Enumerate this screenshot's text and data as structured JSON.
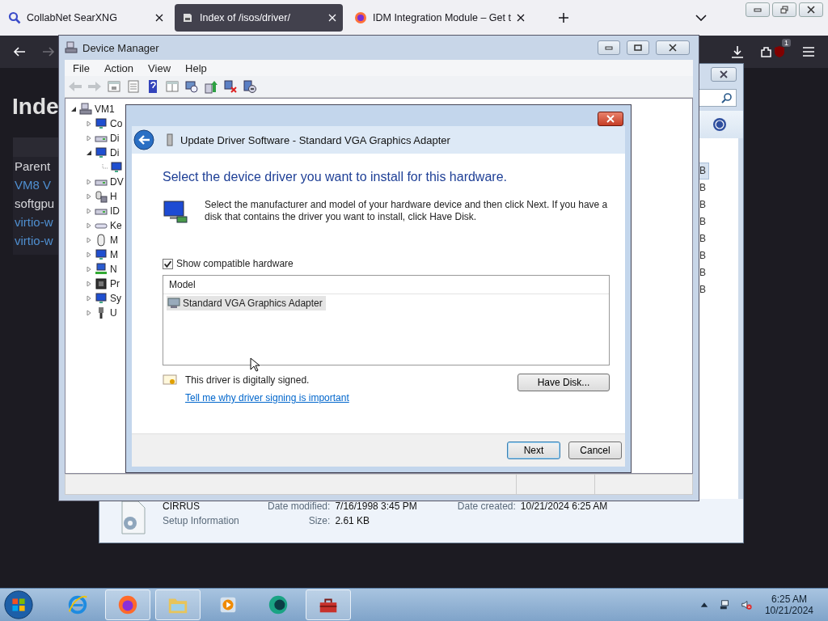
{
  "browser": {
    "tabs": [
      {
        "title": "CollabNet SearXNG",
        "selected": false,
        "kind": "search"
      },
      {
        "title": "Index of /isos/driver/",
        "selected": true,
        "kind": "page"
      },
      {
        "title": "IDM Integration Module – Get t",
        "selected": false,
        "kind": "firefox"
      }
    ],
    "toolbar": {
      "forward_disabled": true,
      "extension_badge": "1"
    },
    "page": {
      "heading": "Inde",
      "rows": [
        {
          "text": "Parent",
          "link": false
        },
        {
          "text": "VM8 V",
          "link": true
        },
        {
          "text": "softgpu",
          "link": false
        },
        {
          "text": "virtio-w",
          "link": true
        },
        {
          "text": "virtio-w",
          "link": true
        }
      ]
    }
  },
  "explorer": {
    "size_column": [
      {
        "text": "B",
        "selected": true
      },
      {
        "text": "B",
        "selected": false
      },
      {
        "text": "B",
        "selected": false
      },
      {
        "text": "B",
        "selected": false
      },
      {
        "text": "B",
        "selected": false
      },
      {
        "text": "B",
        "selected": false
      },
      {
        "text": "B",
        "selected": false
      },
      {
        "text": "B",
        "selected": false
      }
    ],
    "details": {
      "name": "CIRRUS",
      "type": "Setup Information",
      "fields": [
        {
          "label": "Date modified:",
          "value": "7/16/1998 3:45 PM"
        },
        {
          "label": "Size:",
          "value": "2.61 KB"
        },
        {
          "label": "Date created:",
          "value": "10/21/2024 6:25 AM"
        }
      ]
    }
  },
  "device_manager": {
    "title": "Device Manager",
    "menu": [
      "File",
      "Action",
      "View",
      "Help"
    ],
    "toolbar": [
      {
        "kind": "back",
        "disabled": true
      },
      {
        "kind": "forward",
        "disabled": true
      },
      {
        "kind": "console",
        "disabled": false
      },
      {
        "kind": "properties",
        "disabled": false
      },
      {
        "kind": "help",
        "disabled": false
      },
      {
        "kind": "panel",
        "disabled": false
      },
      {
        "kind": "scan",
        "disabled": false
      },
      {
        "kind": "update",
        "disabled": false
      },
      {
        "kind": "uninstall",
        "disabled": false
      },
      {
        "kind": "disable",
        "disabled": false
      }
    ],
    "tree": [
      {
        "label": "VM1",
        "kind": "computer",
        "expanded": true,
        "children": [
          {
            "label": "Co",
            "kind": "monitor",
            "expanded": false
          },
          {
            "label": "Di",
            "kind": "drive",
            "expanded": false
          },
          {
            "label": "Di",
            "kind": "monitor",
            "expanded": true,
            "children": [
              {
                "kind": "monitor"
              }
            ]
          },
          {
            "label": "DV",
            "kind": "drive",
            "expanded": false
          },
          {
            "label": "H",
            "kind": "hid",
            "expanded": false
          },
          {
            "label": "ID",
            "kind": "drive",
            "expanded": false
          },
          {
            "label": "Ke",
            "kind": "keyboard",
            "expanded": false
          },
          {
            "label": "M",
            "kind": "mouse",
            "expanded": false
          },
          {
            "label": "M",
            "kind": "monitor",
            "expanded": false
          },
          {
            "label": "N",
            "kind": "network",
            "expanded": false
          },
          {
            "label": "Pr",
            "kind": "chip",
            "expanded": false
          },
          {
            "label": "Sy",
            "kind": "monitor",
            "expanded": false
          },
          {
            "label": "U",
            "kind": "usb",
            "expanded": false
          }
        ]
      }
    ]
  },
  "dialog": {
    "title": "Update Driver Software - Standard VGA Graphics Adapter",
    "heading": "Select the device driver you want to install for this hardware.",
    "description": "Select the manufacturer and model of your hardware device and then click Next. If you have a disk that contains the driver you want to install, click Have Disk.",
    "show_compatible": {
      "label": "Show compatible hardware",
      "checked": true
    },
    "list": {
      "column": "Model",
      "items": [
        {
          "name": "Standard VGA Graphics Adapter",
          "selected": true
        }
      ]
    },
    "signature": "This driver is digitally signed.",
    "link": "Tell me why driver signing is important",
    "have_disk": "Have Disk...",
    "next": "Next",
    "cancel": "Cancel"
  },
  "taskbar": {
    "apps": [
      {
        "kind": "ie",
        "open": false
      },
      {
        "kind": "firefox",
        "open": true
      },
      {
        "kind": "explorer",
        "open": true
      },
      {
        "kind": "media",
        "open": false
      },
      {
        "kind": "green",
        "open": false
      },
      {
        "kind": "toolbox",
        "open": true
      }
    ],
    "time": "6:25 AM",
    "date": "10/21/2024"
  }
}
